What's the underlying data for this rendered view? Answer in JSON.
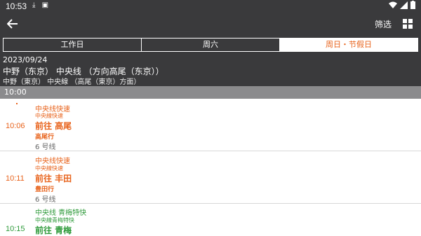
{
  "status": {
    "time": "10:53"
  },
  "toolbar": {
    "filter_label": "筛选"
  },
  "tabs": [
    {
      "label": "工作日",
      "active": false
    },
    {
      "label": "周六",
      "active": false
    },
    {
      "label": "周日・节假日",
      "active": true
    }
  ],
  "header": {
    "date": "2023/09/24",
    "station_main": "中野（东京） 中央线 （方向高尾（东京））",
    "station_sub": "中野（東京） 中央線 （高尾（東京）方面）"
  },
  "hour": "10:00",
  "departures": [
    {
      "time": "10:06",
      "line": "中央线快速",
      "line_jp": "中央線快速",
      "dest": "前往 高尾",
      "dest_jp": "高尾行",
      "track": "6 号线",
      "color": "#e8631c"
    },
    {
      "time": "10:11",
      "line": "中央线快速",
      "line_jp": "中央線快速",
      "dest": "前往 丰田",
      "dest_jp": "豊田行",
      "track": "6 号线",
      "color": "#e8631c"
    },
    {
      "time": "10:15",
      "line": "中央线 青梅特快",
      "line_jp": "中央線青梅特快",
      "dest": "前往 青梅",
      "color": "#2e9a3a"
    }
  ],
  "colors": {
    "accent": "#e8631c",
    "green": "#2e9a3a",
    "bar": "#3a3a3c"
  }
}
